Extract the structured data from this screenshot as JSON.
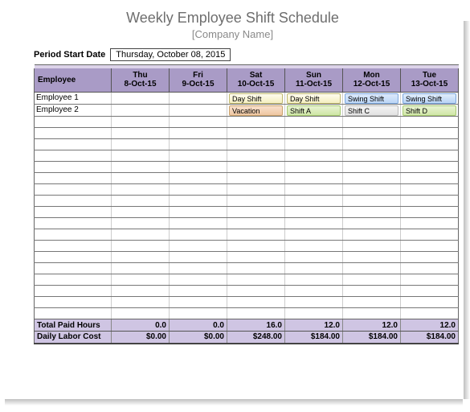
{
  "title": "Weekly Employee Shift Schedule",
  "subtitle": "[Company Name]",
  "period_label": "Period Start Date",
  "period_value": "Thursday, October 08, 2015",
  "headers": {
    "employee": "Employee",
    "days": [
      {
        "day": "Thu",
        "date": "8-Oct-15"
      },
      {
        "day": "Fri",
        "date": "9-Oct-15"
      },
      {
        "day": "Sat",
        "date": "10-Oct-15"
      },
      {
        "day": "Sun",
        "date": "11-Oct-15"
      },
      {
        "day": "Mon",
        "date": "12-Oct-15"
      },
      {
        "day": "Tue",
        "date": "13-Oct-15"
      }
    ]
  },
  "employees": [
    "Employee 1",
    "Employee 2"
  ],
  "shifts": {
    "emp1": {
      "sat": "Day Shift",
      "sun": "Day Shift",
      "mon": "Swing Shift",
      "tue": "Swing Shift"
    },
    "emp2": {
      "sat": "Vacation",
      "sun": "Shift A",
      "mon": "Shift C",
      "tue": "Shift D"
    }
  },
  "totals": {
    "paid_label": "Total Paid Hours",
    "paid": [
      "0.0",
      "0.0",
      "16.0",
      "12.0",
      "12.0",
      "12.0"
    ],
    "cost_label": "Daily Labor Cost",
    "cost": [
      "$0.00",
      "$0.00",
      "$248.00",
      "$184.00",
      "$184.00",
      "$184.00"
    ]
  },
  "chart_data": {
    "type": "table",
    "title": "Weekly Employee Shift Schedule",
    "columns": [
      "Employee",
      "Thu 8-Oct-15",
      "Fri 9-Oct-15",
      "Sat 10-Oct-15",
      "Sun 11-Oct-15",
      "Mon 12-Oct-15",
      "Tue 13-Oct-15"
    ],
    "rows": [
      [
        "Employee 1",
        "",
        "",
        "Day Shift",
        "Day Shift",
        "Swing Shift",
        "Swing Shift"
      ],
      [
        "Employee 2",
        "",
        "",
        "Vacation",
        "Shift A",
        "Shift C",
        "Shift D"
      ]
    ],
    "totals": {
      "Total Paid Hours": [
        0.0,
        0.0,
        16.0,
        12.0,
        12.0,
        12.0
      ],
      "Daily Labor Cost": [
        0.0,
        0.0,
        248.0,
        184.0,
        184.0,
        184.0
      ]
    }
  }
}
